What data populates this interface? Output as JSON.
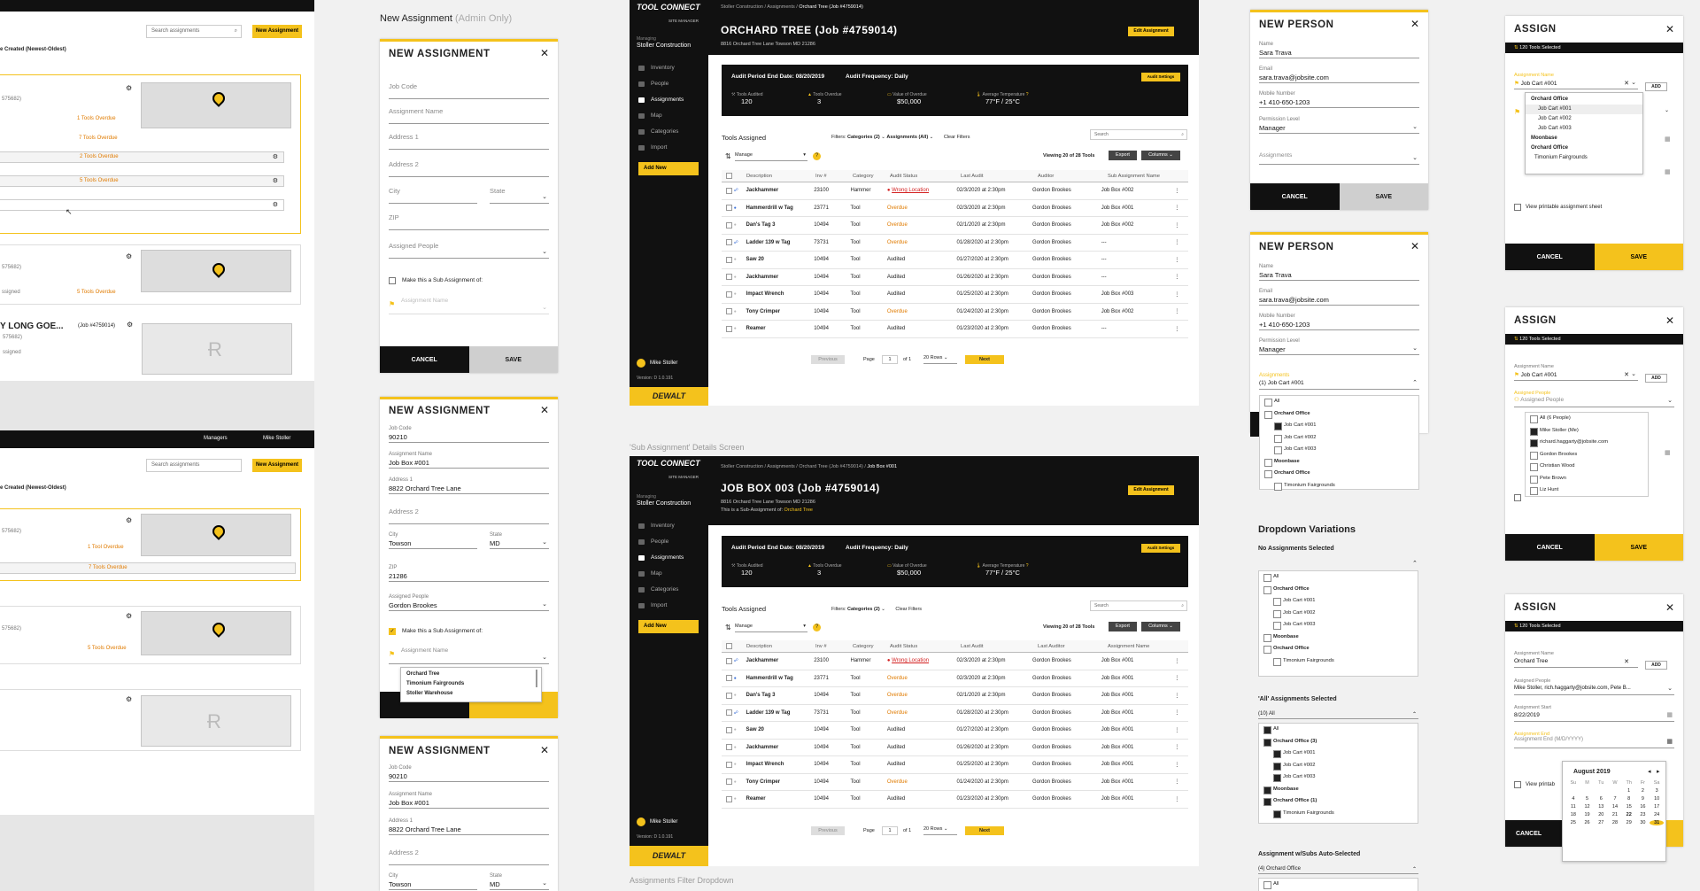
{
  "col1": {
    "top": {
      "search_ph": "Search assignments",
      "new_btn": "New Assignment",
      "sort": "e Created (Newest-Oldest)",
      "pid1": "575682)",
      "overdue1": "1 Tools Overdue",
      "rows": [
        {
          "overdue": "7 Tools Overdue"
        },
        {
          "overdue": "2 Tools Overdue"
        },
        {
          "overdue": "5 Tools Overdue"
        },
        {
          "overdue": ""
        }
      ],
      "pid2": "575682)",
      "assigned": "ssigned",
      "overdue2": "5 Tools Overdue",
      "long_title": "Y LONG GOE...",
      "long_job": "(Job #4759014)",
      "pid3": "575682)",
      "assigned2": "ssigned"
    },
    "bottom": {
      "managers": "Managers",
      "user": "Mike Stoller",
      "search_ph": "Search assignments",
      "new_btn": "New Assignment",
      "sort": "e Created (Newest-Oldest)",
      "pid1": "575682)",
      "overdue1": "1 Tool Overdue",
      "row_overdue": "7 Tools Overdue",
      "pid2": "575682)",
      "overdue2": "5 Tools Overdue"
    }
  },
  "new_assign_heading": {
    "main": "New Assignment",
    "muted": "(Admin Only)"
  },
  "na1": {
    "title": "NEW ASSIGNMENT",
    "fields": [
      "Job Code",
      "Assignment Name",
      "Address 1",
      "Address 2",
      "City",
      "State",
      "ZIP",
      "Assigned People"
    ],
    "sub_label": "Make this a Sub Assignment of:",
    "sub_ph": "Assignment Name",
    "cancel": "CANCEL",
    "save": "SAVE"
  },
  "na2": {
    "title": "NEW ASSIGNMENT",
    "job_code_val": "90210",
    "assign_name_label": "Assignment Name",
    "assign_name_val": "Job Box #001",
    "addr1_label": "Address 1",
    "addr1_val": "8822 Orchard Tree Lane",
    "addr2_label": "Address 2",
    "city_label": "City",
    "city_val": "Towson",
    "state_label": "State",
    "state_val": "MD",
    "zip_label": "ZIP",
    "zip_val": "21286",
    "people_label": "Assigned People",
    "people_val": "Gordon Brookes",
    "sub_label": "Make this a Sub Assignment of:",
    "sub_ph": "Assignment Name",
    "options": [
      "Orchard Tree",
      "Timonium Fairgrounds",
      "Stoller Warehouse"
    ],
    "job_code_label": "Job Code"
  },
  "na3": {
    "title": "NEW ASSIGNMENT",
    "job_code_label": "Job Code",
    "job_code_val": "90210",
    "assign_name_label": "Assignment Name",
    "assign_name_val": "Job Box #001",
    "addr1_label": "Address 1",
    "addr1_val": "8822 Orchard Tree Lane",
    "addr2_label": "Address 2",
    "city_label": "City",
    "city_val": "Towson",
    "state_label": "State",
    "state_val": "MD"
  },
  "app1": {
    "logo": "TOOL CONNECT",
    "logo_sub": "SITE MANAGER",
    "managing": "Managing",
    "org": "Stoller Construction",
    "nav": [
      "Inventory",
      "People",
      "Assignments",
      "Map",
      "Categories",
      "Import"
    ],
    "add_new": "Add New",
    "user": "Mike Stoller",
    "version": "Version: D 1.0.191",
    "brand": "DEWALT",
    "breadcrumb": "Stoller Construction / Assignments /",
    "crumb_cur": "Orchard Tree (Job #4759014)",
    "title": "ORCHARD TREE (Job #4759014)",
    "address": "8816 Orchard Tree Lane Towson MD 21286",
    "edit_btn": "Edit Assignment",
    "audit_end": "Audit Period End Date: 08/20/2019",
    "audit_freq": "Audit Frequency: Daily",
    "audit_settings": "Audit Settings",
    "stats": [
      {
        "label": "Tools Audited",
        "value": "120"
      },
      {
        "label": "Tools Overdue",
        "value": "3"
      },
      {
        "label": "Value of Overdue",
        "value": "$50,000"
      },
      {
        "label": "Average Temperature",
        "value": "77°F / 25°C"
      }
    ],
    "tools_assigned": "Tools Assigned",
    "filters": "Filters:",
    "cat_filter": "Categories (2)",
    "assign_filter": "Assignments (All)",
    "clear": "Clear Filters",
    "search_ph": "Search",
    "manage": "Manage",
    "viewing": "Viewing 20 of 28 Tools",
    "export": "Export",
    "columns": "Columns",
    "headers": [
      "Description",
      "Inv #",
      "Category",
      "Audit Status",
      "Last Audit",
      "Auditor",
      "Sub Assignment Name"
    ],
    "rows": [
      [
        "Jackhammer",
        "23100",
        "Hammer",
        "Wrong Location",
        "02/3/2020 at 2:30pm",
        "Gordon Brookes",
        "Job Box #002"
      ],
      [
        "Hammerdrill w Tag",
        "23771",
        "Tool",
        "Overdue",
        "02/3/2020 at 2:30pm",
        "Gordon Brookes",
        "Job Box #001"
      ],
      [
        "Dan's Tag 3",
        "10494",
        "Tool",
        "Overdue",
        "02/1/2020 at 2:30pm",
        "Gordon Brookes",
        "Job Box #002"
      ],
      [
        "Ladder 139 w Tag",
        "73731",
        "Tool",
        "Overdue",
        "01/28/2020 at 2:30pm",
        "Gordon Brookes",
        "---"
      ],
      [
        "Saw 20",
        "10494",
        "Tool",
        "Audited",
        "01/27/2020 at 2:30pm",
        "Gordon Brookes",
        "---"
      ],
      [
        "Jackhammer",
        "10494",
        "Tool",
        "Audited",
        "01/26/2020 at 2:30pm",
        "Gordon Brookes",
        "---"
      ],
      [
        "Impact Wrench",
        "10494",
        "Tool",
        "Audited",
        "01/25/2020 at 2:30pm",
        "Gordon Brookes",
        "Job Box #003"
      ],
      [
        "Tony Crimper",
        "10494",
        "Tool",
        "Overdue",
        "01/24/2020 at 2:30pm",
        "Gordon Brookes",
        "Job Box #002"
      ],
      [
        "Reamer",
        "10494",
        "Tool",
        "Audited",
        "01/23/2020 at 2:30pm",
        "Gordon Brookes",
        "---"
      ]
    ],
    "prev": "Previous",
    "page": "Page",
    "page_num": "1",
    "of": "of 1",
    "rows_sel": "20 Rows",
    "next": "Next"
  },
  "sub_caption": "'Sub Assignment' Details Screen",
  "app2": {
    "logo": "TOOL CONNECT",
    "logo_sub": "SITE MANAGER",
    "managing": "Managing",
    "org": "Stoller Construction",
    "nav": [
      "Inventory",
      "People",
      "Assignments",
      "Map",
      "Categories",
      "Import"
    ],
    "add_new": "Add New",
    "user": "Mike Stoller",
    "version": "Version: D 1.0.191",
    "brand": "DEWALT",
    "breadcrumb": "Stoller Construction / Assignments / Orchard Tree (Job #4759014) /",
    "crumb_cur": "Job Box #001",
    "title": "JOB BOX 003 (Job #4759014)",
    "address": "8816 Orchard Tree Lane Towson MD 21286",
    "sub_of": "This is a Sub-Assignment of:",
    "sub_of_link": "Orchard Tree",
    "edit_btn": "Edit Assignment",
    "audit_end": "Audit Period End Date: 08/20/2019",
    "audit_freq": "Audit Frequency: Daily",
    "audit_settings": "Audit Settings",
    "stats": [
      {
        "label": "Tools Audited",
        "value": "120"
      },
      {
        "label": "Tools Overdue",
        "value": "3"
      },
      {
        "label": "Value of Overdue",
        "value": "$50,000"
      },
      {
        "label": "Average Temperature",
        "value": "77°F / 25°C"
      }
    ],
    "tools_assigned": "Tools Assigned",
    "filters": "Filters:",
    "cat_filter": "Categories (2)",
    "clear": "Clear Filters",
    "search_ph": "Search",
    "manage": "Manage",
    "viewing": "Viewing 20 of 28 Tools",
    "export": "Export",
    "columns": "Columns",
    "headers": [
      "Description",
      "Inv #",
      "Category",
      "Audit Status",
      "Last Audit",
      "Last Auditor",
      "Assignment Name"
    ],
    "rows": [
      [
        "Jackhammer",
        "23100",
        "Hammer",
        "Wrong Location",
        "02/3/2020 at 2:30pm",
        "Gordon Brookes",
        "Job Box #001"
      ],
      [
        "Hammerdrill w Tag",
        "23771",
        "Tool",
        "Overdue",
        "02/3/2020 at 2:30pm",
        "Gordon Brookes",
        "Job Box #001"
      ],
      [
        "Dan's Tag 3",
        "10494",
        "Tool",
        "Overdue",
        "02/1/2020 at 2:30pm",
        "Gordon Brookes",
        "Job Box #001"
      ],
      [
        "Ladder 139 w Tag",
        "73731",
        "Tool",
        "Overdue",
        "01/28/2020 at 2:30pm",
        "Gordon Brookes",
        "Job Box #001"
      ],
      [
        "Saw 20",
        "10494",
        "Tool",
        "Audited",
        "01/27/2020 at 2:30pm",
        "Gordon Brookes",
        "Job Box #001"
      ],
      [
        "Jackhammer",
        "10494",
        "Tool",
        "Audited",
        "01/26/2020 at 2:30pm",
        "Gordon Brookes",
        "Job Box #001"
      ],
      [
        "Impact Wrench",
        "10494",
        "Tool",
        "Audited",
        "01/25/2020 at 2:30pm",
        "Gordon Brookes",
        "Job Box #001"
      ],
      [
        "Tony Crimper",
        "10494",
        "Tool",
        "Overdue",
        "01/24/2020 at 2:30pm",
        "Gordon Brookes",
        "Job Box #001"
      ],
      [
        "Reamer",
        "10494",
        "Tool",
        "Audited",
        "01/23/2020 at 2:30pm",
        "Gordon Brookes",
        "Job Box #001"
      ]
    ],
    "prev": "Previous",
    "page": "Page",
    "page_num": "1",
    "of": "of 1",
    "rows_sel": "20 Rows",
    "next": "Next"
  },
  "filter_caption": "Assignments Filter Dropdown",
  "np1": {
    "title": "NEW PERSON",
    "name_label": "Name",
    "name_val": "Sara Trava",
    "email_label": "Email",
    "email_val": "sara.trava@jobsite.com",
    "mobile_label": "Mobile Number",
    "mobile_val": "+1 410-650-1203",
    "perm_label": "Permission Level",
    "perm_val": "Manager",
    "assign_ph": "Assignments",
    "cancel": "CANCEL",
    "save": "SAVE"
  },
  "np2": {
    "title": "NEW PERSON",
    "name_label": "Name",
    "name_val": "Sara Trava",
    "email_label": "Email",
    "email_val": "sara.trava@jobsite.com",
    "mobile_label": "Mobile Number",
    "mobile_val": "+1 410-650-1203",
    "perm_label": "Permission Level",
    "perm_val": "Manager",
    "assign_label": "Assignments",
    "assign_val": "(1) Job Cart #001",
    "items": [
      "All",
      "Orchard Office",
      "Job Cart #001",
      "Job Cart #002",
      "Job Cart #003",
      "Moonbase",
      "Orchard Office",
      "Timonium Fairgrounds"
    ]
  },
  "ddv": {
    "title": "Dropdown Variations",
    "no_sel": "No Assignments Selected",
    "no_items": [
      "All",
      "Orchard Office",
      "Job Cart #001",
      "Job Cart #002",
      "Job Cart #003",
      "Moonbase",
      "Orchard Office",
      "Timonium Fairgrounds"
    ],
    "all_sel": "'All' Assignments Selected",
    "all_val": "(10) All",
    "all_items": [
      "All",
      "Orchard Office (3)",
      "Job Cart #001",
      "Job Cart #002",
      "Job Cart #003",
      "Moonbase",
      "Orchard Office (1)",
      "Timonium Fairgrounds"
    ],
    "auto": "Assignment w/Subs Auto-Selected",
    "auto_val": "(4) Orchard Office",
    "auto_items": [
      "All"
    ]
  },
  "as1": {
    "title": "ASSIGN",
    "sel": "120 Tools Selected",
    "name_label": "Assignment Name",
    "name_val": "Job Cart #001",
    "add": "ADD",
    "opts": [
      "Orchard Office",
      "Job Cart #001",
      "Job Cart #002",
      "Job Cart #003",
      "Moonbase",
      "Orchard Office",
      "Timonium Fairgrounds"
    ],
    "printable": "View printable assignment sheet",
    "cancel": "CANCEL",
    "save": "SAVE"
  },
  "as2": {
    "title": "ASSIGN",
    "sel": "120 Tools Selected",
    "name_label": "Assignment Name",
    "name_val": "Job Cart #001",
    "add": "ADD",
    "people_label": "Assigned People",
    "people_ph": "Assigned People",
    "opts": [
      "All (6 People)",
      "Mike Stoller (Me)",
      "richard.haggarty@jobsite.com",
      "Gordon Brookes",
      "Christian Wood",
      "Pete Brown",
      "Liz Hunt"
    ],
    "cancel": "CANCEL",
    "save": "SAVE"
  },
  "as3": {
    "title": "ASSIGN",
    "sel": "120 Tools Selected",
    "name_label": "Assignment Name",
    "name_val": "Orchard Tree",
    "add": "ADD",
    "people_label": "Assigned People",
    "people_val": "Mike Stoller, rich.haggarty@jobsite.com, Pete B...",
    "start_label": "Assignment Start",
    "start_val": "8/22/2019",
    "end_label": "Assignment End",
    "end_ph": "Assignment End (M/D/YYYY)",
    "printable": "View printab",
    "cancel": "CANCEL",
    "month": "August 2019",
    "dow": [
      "Su",
      "M",
      "Tu",
      "W",
      "Th",
      "Fr",
      "Sa"
    ],
    "days": [
      "",
      "",
      "",
      "",
      "1",
      "2",
      "3",
      "4",
      "5",
      "6",
      "7",
      "8",
      "9",
      "10",
      "11",
      "12",
      "13",
      "14",
      "15",
      "16",
      "17",
      "18",
      "19",
      "20",
      "21",
      "22",
      "23",
      "24",
      "25",
      "26",
      "27",
      "28",
      "29",
      "30",
      "31"
    ]
  },
  "colors": {
    "accent": "#f4c21c",
    "dark": "#111111",
    "overdue": "#e07b00",
    "wrong": "#d32020"
  }
}
